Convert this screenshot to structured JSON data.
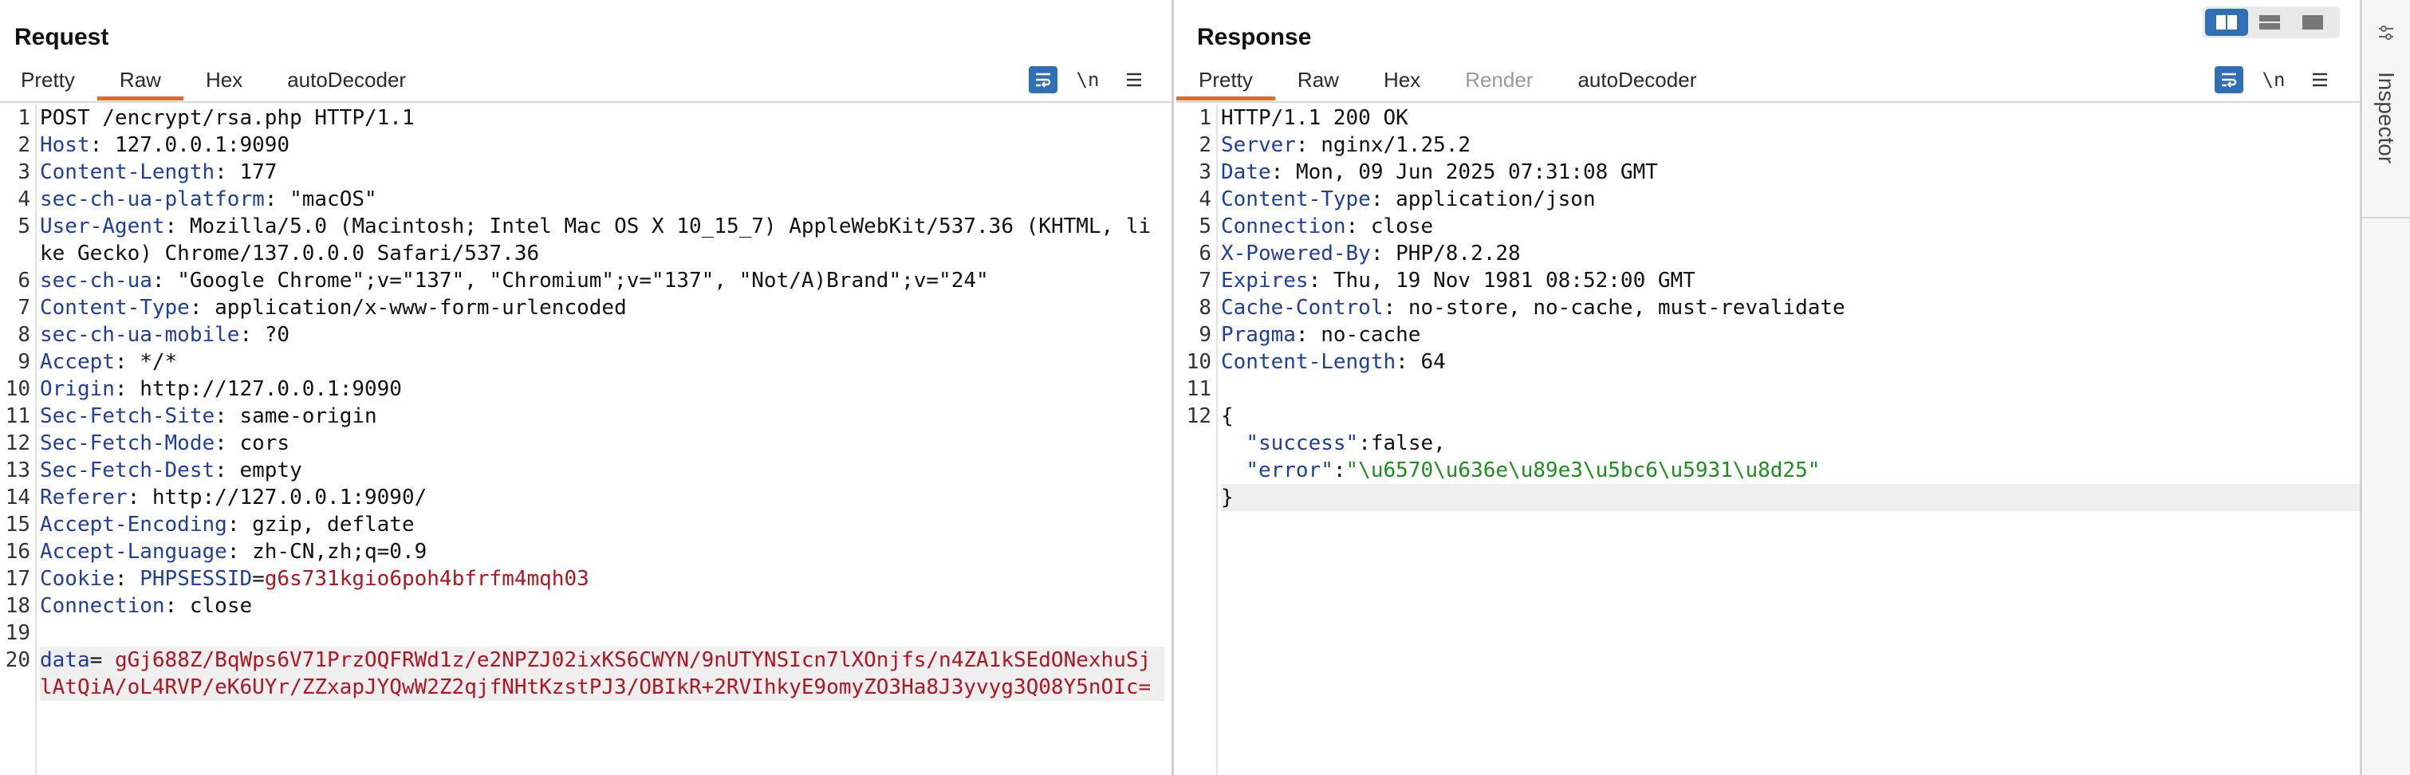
{
  "request": {
    "title": "Request",
    "tabs": [
      "Pretty",
      "Raw",
      "Hex",
      "autoDecoder"
    ],
    "active_tab": "Raw",
    "newline_label": "\\n",
    "lines": [
      {
        "n": "1",
        "key": "",
        "value": "POST /encrypt/rsa.php HTTP/1.1"
      },
      {
        "n": "2",
        "key": "Host",
        "value": "127.0.0.1:9090"
      },
      {
        "n": "3",
        "key": "Content-Length",
        "value": "177"
      },
      {
        "n": "4",
        "key": "sec-ch-ua-platform",
        "value": "\"macOS\""
      },
      {
        "n": "5",
        "key": "User-Agent",
        "value": "Mozilla/5.0 (Macintosh; Intel Mac OS X 10_15_7) AppleWebKit/537.36 (KHTML, like Gecko) Chrome/137.0.0.0 Safari/537.36"
      },
      {
        "n": "6",
        "key": "sec-ch-ua",
        "value": "\"Google Chrome\";v=\"137\", \"Chromium\";v=\"137\", \"Not/A)Brand\";v=\"24\""
      },
      {
        "n": "7",
        "key": "Content-Type",
        "value": "application/x-www-form-urlencoded"
      },
      {
        "n": "8",
        "key": "sec-ch-ua-mobile",
        "value": "?0"
      },
      {
        "n": "9",
        "key": "Accept",
        "value": "*/*"
      },
      {
        "n": "10",
        "key": "Origin",
        "value": "http://127.0.0.1:9090"
      },
      {
        "n": "11",
        "key": "Sec-Fetch-Site",
        "value": "same-origin"
      },
      {
        "n": "12",
        "key": "Sec-Fetch-Mode",
        "value": "cors"
      },
      {
        "n": "13",
        "key": "Sec-Fetch-Dest",
        "value": "empty"
      },
      {
        "n": "14",
        "key": "Referer",
        "value": "http://127.0.0.1:9090/"
      },
      {
        "n": "15",
        "key": "Accept-Encoding",
        "value": "gzip, deflate"
      },
      {
        "n": "16",
        "key": "Accept-Language",
        "value": "zh-CN,zh;q=0.9"
      },
      {
        "n": "17",
        "key": "Cookie",
        "cookie_name": "PHPSESSID",
        "cookie_value": "g6s731kgio6poh4bfrfm4mqh03"
      },
      {
        "n": "18",
        "key": "Connection",
        "value": "close"
      },
      {
        "n": "19",
        "key": "",
        "value": ""
      },
      {
        "n": "20",
        "param_name": "data",
        "param_value": "gGj688Z/BqWps6V71PrzOQFRWd1z/e2NPZJ02ixKS6CWYN/9nUTYNSIcn7lXOnjfs/n4ZA1kSEdONexhuSjlAtQiA/oL4RVP/eK6UYr/ZZxapJYQwW2Z2qjfNHtKzstPJ3/OBIkR+2RVIhkyE9omyZO3Ha8J3yvyg3Q08Y5nOIc="
      }
    ]
  },
  "response": {
    "title": "Response",
    "tabs": [
      "Pretty",
      "Raw",
      "Hex",
      "Render",
      "autoDecoder"
    ],
    "active_tab": "Pretty",
    "newline_label": "\\n",
    "lines": [
      {
        "n": "1",
        "key": "",
        "value": "HTTP/1.1 200 OK"
      },
      {
        "n": "2",
        "key": "Server",
        "value": "nginx/1.25.2"
      },
      {
        "n": "3",
        "key": "Date",
        "value": "Mon, 09 Jun 2025 07:31:08 GMT"
      },
      {
        "n": "4",
        "key": "Content-Type",
        "value": "application/json"
      },
      {
        "n": "5",
        "key": "Connection",
        "value": "close"
      },
      {
        "n": "6",
        "key": "X-Powered-By",
        "value": "PHP/8.2.28"
      },
      {
        "n": "7",
        "key": "Expires",
        "value": "Thu, 19 Nov 1981 08:52:00 GMT"
      },
      {
        "n": "8",
        "key": "Cache-Control",
        "value": "no-store, no-cache, must-revalidate"
      },
      {
        "n": "9",
        "key": "Pragma",
        "value": "no-cache"
      },
      {
        "n": "10",
        "key": "Content-Length",
        "value": "64"
      },
      {
        "n": "11",
        "key": "",
        "value": ""
      }
    ],
    "body": {
      "n": "12",
      "open": "{",
      "success_key": "\"success\"",
      "success_value": "false,",
      "error_key": "\"error\"",
      "error_value": "\"\\u6570\\u636e\\u89e3\\u5bc6\\u5931\\u8d25\"",
      "close": "}"
    }
  },
  "inspector": {
    "label": "Inspector"
  },
  "colors": {
    "accent": "#2f6fb6",
    "tab_underline": "#e8672a",
    "header_key": "#1f3fa0",
    "red_value": "#b01622",
    "json_string": "#1b8f1b"
  }
}
